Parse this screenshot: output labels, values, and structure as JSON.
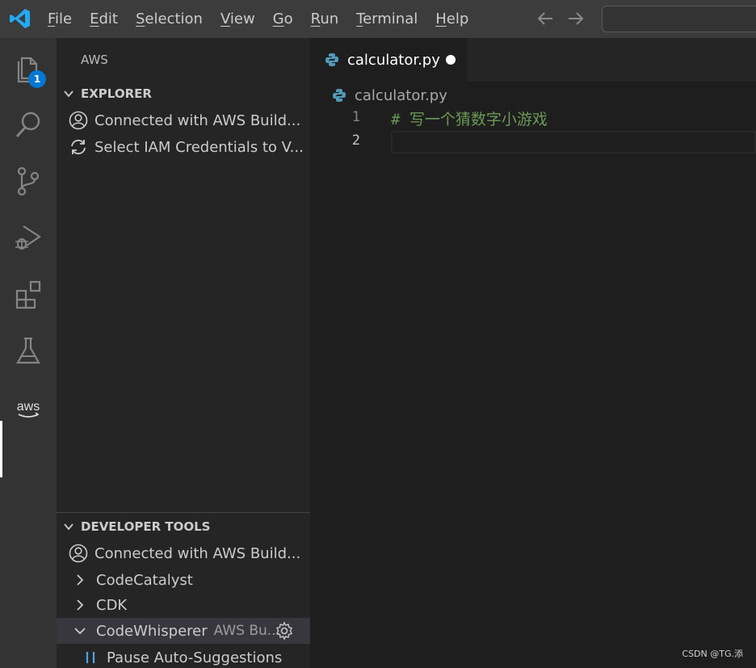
{
  "titlebar": {
    "menu": [
      {
        "mnemonic": "F",
        "rest": "ile"
      },
      {
        "mnemonic": "E",
        "rest": "dit"
      },
      {
        "mnemonic": "S",
        "rest": "election"
      },
      {
        "mnemonic": "V",
        "rest": "iew"
      },
      {
        "mnemonic": "G",
        "rest": "o"
      },
      {
        "mnemonic": "R",
        "rest": "un"
      },
      {
        "mnemonic": "T",
        "rest": "erminal"
      },
      {
        "mnemonic": "H",
        "rest": "elp"
      }
    ]
  },
  "activitybar": {
    "explorer_badge": "1",
    "aws_label": "aws"
  },
  "sidebar": {
    "title": "AWS",
    "explorer": {
      "header": "EXPLORER",
      "items": [
        {
          "label": "Connected with AWS Build..."
        },
        {
          "label": "Select IAM Credentials to V..."
        }
      ]
    },
    "developer_tools": {
      "header": "DEVELOPER TOOLS",
      "items": [
        {
          "label": "Connected with AWS Build..."
        },
        {
          "label": "CodeCatalyst"
        },
        {
          "label": "CDK"
        },
        {
          "label": "CodeWhisperer",
          "description": "AWS Bu..."
        },
        {
          "label": "Pause Auto-Suggestions"
        }
      ]
    }
  },
  "editor": {
    "tab": {
      "label": "calculator.py"
    },
    "breadcrumb": "calculator.py",
    "lines": [
      {
        "number": "1",
        "text": "# 写一个猜数字小游戏"
      },
      {
        "number": "2",
        "text": ""
      }
    ]
  },
  "watermark": "CSDN @TG.添",
  "colors": {
    "accent": "#0078d4",
    "comment": "#6a9955",
    "python_blue": "#519aba"
  }
}
